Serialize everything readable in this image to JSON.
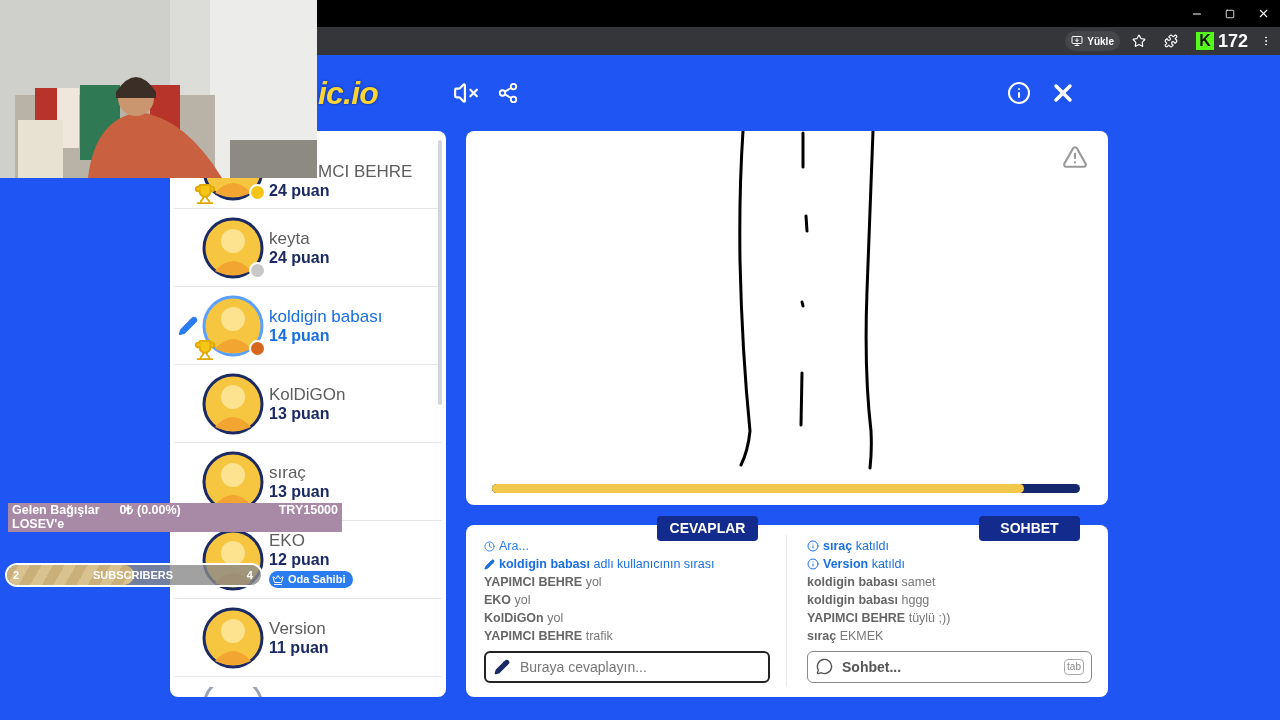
{
  "browser": {
    "install_button": "Yükle",
    "counter_badge": {
      "letter": "K",
      "count": "172"
    }
  },
  "logo": {
    "text": "ic.io"
  },
  "players": [
    {
      "kind": "top_cut",
      "name": "MCI BEHRE",
      "points": "24 puan",
      "trophy": true,
      "color": "#f5c518",
      "drawing": false
    },
    {
      "kind": "full",
      "name": "keyta",
      "points": "24 puan",
      "trophy": false,
      "color": "#c8c8c8",
      "drawing": false
    },
    {
      "kind": "full",
      "name": "koldigin babası",
      "points": "14 puan",
      "trophy": true,
      "color": "#d9661f",
      "drawing": true
    },
    {
      "kind": "full",
      "name": "KolDiGOn",
      "points": "13 puan",
      "trophy": false,
      "drawing": false
    },
    {
      "kind": "full",
      "name": "sıraç",
      "points": "13 puan",
      "trophy": false,
      "drawing": false
    },
    {
      "kind": "full",
      "name": "EKO",
      "points": "12 puan",
      "trophy": false,
      "drawing": false,
      "badge": "Oda Sahibi"
    },
    {
      "kind": "full",
      "name": "Version",
      "points": "11 puan",
      "trophy": false,
      "drawing": false
    },
    {
      "kind": "bottom_cut"
    }
  ],
  "canvas": {
    "timer": {
      "level": 0.905
    }
  },
  "answers": {
    "tab": "CEVAPLAR",
    "placeholder": "Buraya cevaplayın...",
    "lines": [
      {
        "kind": "timer",
        "text": "Ara..."
      },
      {
        "kind": "turn",
        "name": "koldigin babası",
        "text": "adlı kullanıcının sırası"
      },
      {
        "kind": "message",
        "name": "YAPIMCI BEHRE",
        "text": "yol"
      },
      {
        "kind": "message",
        "name": "EKO",
        "text": "yol"
      },
      {
        "kind": "message",
        "name": "KolDiGOn",
        "text": "yol"
      },
      {
        "kind": "message",
        "name": "YAPIMCI BEHRE",
        "text": "trafik"
      }
    ]
  },
  "chat": {
    "tab": "SOHBET",
    "placeholder": "Sohbet...",
    "key_hint": "tab",
    "lines": [
      {
        "kind": "join",
        "name": "sıraç",
        "text": "katıldı"
      },
      {
        "kind": "join",
        "name": "Version",
        "text": "katıldı"
      },
      {
        "kind": "message",
        "name": "koldigin babası",
        "text": "samet"
      },
      {
        "kind": "message",
        "name": "koldigin babası",
        "text": "hggg"
      },
      {
        "kind": "message",
        "name": "YAPIMCI BEHRE",
        "text": "tüylü ;))"
      },
      {
        "kind": "message",
        "name": "sıraç",
        "text": "EKMEK"
      }
    ]
  },
  "donation_overlay": {
    "title": "Gelen Bağışlar",
    "amount": "0₺ (0.00%)",
    "goal": "TRY15000",
    "recipient": "LOSEV'e"
  },
  "subscribers_overlay": {
    "current": "2",
    "label": "SUBSCRIBERS",
    "goal": "4",
    "level": 0.5
  }
}
